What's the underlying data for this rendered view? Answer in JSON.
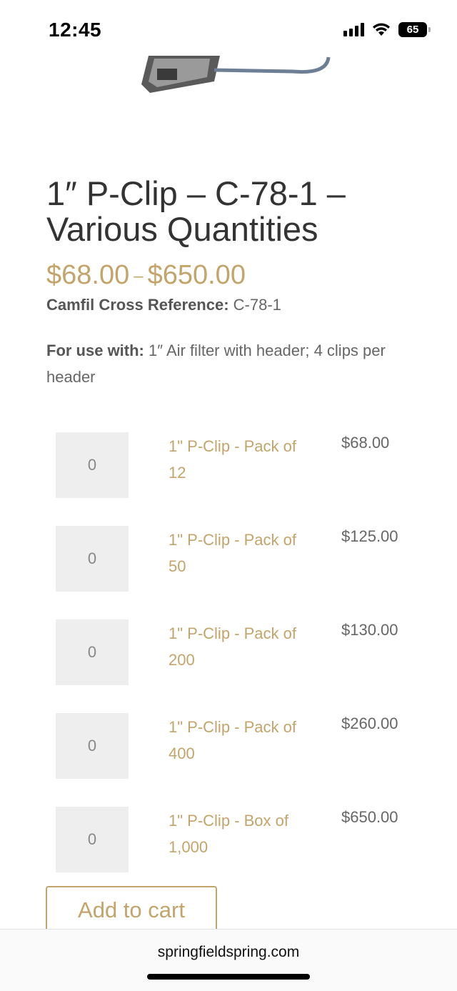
{
  "status_bar": {
    "time": "12:45",
    "battery": "65"
  },
  "product": {
    "title": "1″ P-Clip – C-78-1 – Various Quantities",
    "price_low": "$68.00",
    "price_high": "$650.00",
    "price_separator": "–",
    "cross_reference_label": "Camfil Cross Reference:",
    "cross_reference_value": "C-78-1",
    "use_with_label": "For use with:",
    "use_with_value": "1″ Air filter with header; 4 clips per header"
  },
  "variants": [
    {
      "qty": "0",
      "name": "1\" P-Clip - Pack of 12",
      "price": "$68.00"
    },
    {
      "qty": "0",
      "name": "1\" P-Clip - Pack of 50",
      "price": "$125.00"
    },
    {
      "qty": "0",
      "name": "1\" P-Clip - Pack of 200",
      "price": "$130.00"
    },
    {
      "qty": "0",
      "name": "1\" P-Clip - Pack of 400",
      "price": "$260.00"
    },
    {
      "qty": "0",
      "name": "1\" P-Clip - Box of 1,000",
      "price": "$650.00"
    }
  ],
  "add_to_cart_label": "Add to cart",
  "browser": {
    "url": "springfieldspring.com"
  },
  "colors": {
    "accent": "#c3a46a",
    "text": "#333333",
    "muted": "#666666",
    "input_bg": "#eeeeee"
  },
  "icons": [
    "signal-icon",
    "wifi-icon",
    "battery-icon"
  ]
}
